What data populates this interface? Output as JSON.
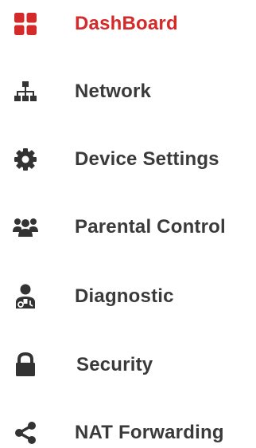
{
  "menu": {
    "items": [
      {
        "label": "DashBoard",
        "icon": "dashboard-grid-icon",
        "active": true
      },
      {
        "label": "Network",
        "icon": "network-topology-icon",
        "active": false
      },
      {
        "label": "Device Settings",
        "icon": "gear-icon",
        "active": false
      },
      {
        "label": "Parental Control",
        "icon": "user-group-icon",
        "active": false
      },
      {
        "label": "Diagnostic",
        "icon": "doctor-icon",
        "active": false
      },
      {
        "label": "Security",
        "icon": "lock-icon",
        "active": false
      },
      {
        "label": "NAT Forwarding",
        "icon": "share-icon",
        "active": false
      }
    ]
  },
  "colors": {
    "active": "#d42a2a",
    "inactive": "#3a3a3a"
  }
}
